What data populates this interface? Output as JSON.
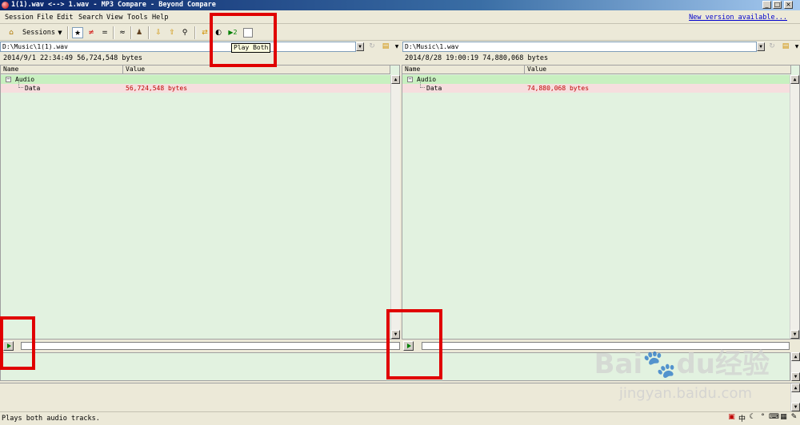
{
  "window": {
    "title": "1(1).wav <--> 1.wav - MP3 Compare - Beyond Compare",
    "minimize": "_",
    "maximize": "□",
    "close": "×"
  },
  "menu": {
    "items": [
      "Session",
      "File",
      "Edit",
      "Search",
      "View",
      "Tools",
      "Help"
    ],
    "new_version": "New version available..."
  },
  "toolbar": {
    "sessions_label": "Sessions",
    "tooltip": "Play Both"
  },
  "left": {
    "path": "D:\\Music\\1(1).wav",
    "info": "2014/9/1 22:34:49  56,724,548 bytes",
    "col_name": "Name",
    "col_value": "Value",
    "rows": [
      {
        "name": "Audio",
        "value": ""
      },
      {
        "name": "Data",
        "value": "56,724,548 bytes"
      }
    ]
  },
  "right": {
    "path": "D:\\Music\\1.wav",
    "info": "2014/8/28 19:00:19  74,880,068 bytes",
    "col_name": "Name",
    "col_value": "Value",
    "rows": [
      {
        "name": "Audio",
        "value": ""
      },
      {
        "name": "Data",
        "value": "74,880,068 bytes"
      }
    ]
  },
  "status": {
    "text": "Plays both audio tracks.",
    "ime_lang": "中"
  },
  "watermark": {
    "brand": "Bai",
    "brand_paw": "du",
    "brand_cn": "经验",
    "url": "jingyan.baidu.com"
  },
  "colors": {
    "pane_bg": "#e2f2e0",
    "audio_row": "#c8f0c0",
    "data_row": "#f6dede",
    "diff_text": "#c00000",
    "highlight": "#e00000"
  }
}
